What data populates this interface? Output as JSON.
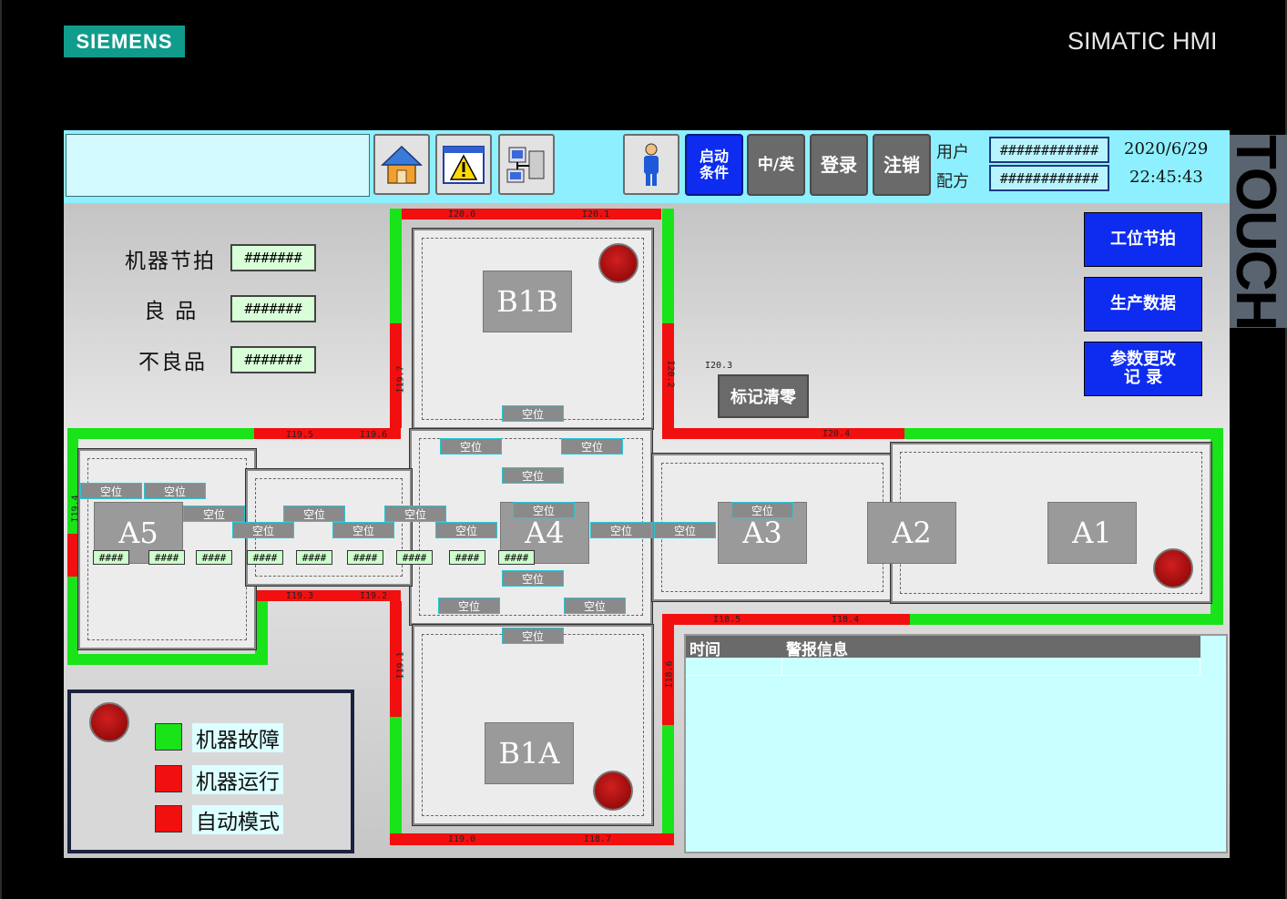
{
  "brand": {
    "logo": "SIEMENS",
    "product": "SIMATIC HMI",
    "panel_label": "TOUCH"
  },
  "topbar": {
    "icons": [
      "home-icon",
      "warning-icon",
      "network-icon",
      "operator-icon"
    ],
    "buttons": {
      "start_condition": "启动\n条件",
      "lang": "中/英",
      "login": "登录",
      "logout": "注销"
    },
    "user_label": "用户",
    "recipe_label": "配方",
    "user_value": "############",
    "recipe_value": "############",
    "date": "2020/6/29",
    "time": "22:45:43"
  },
  "stats": {
    "cycle_label": "机器节拍",
    "good_label": "良 品",
    "bad_label": "不良品",
    "cycle_value": "#######",
    "good_value": "#######",
    "bad_value": "#######"
  },
  "right_buttons": {
    "station_cycle": "工位节拍",
    "production_data": "生产数据",
    "param_log": "参数更改\n记 录"
  },
  "clear": {
    "label": "标记清零",
    "addr": "I20.3"
  },
  "stations": [
    "B1B",
    "B1A",
    "A5",
    "A4",
    "A3",
    "A2",
    "A1"
  ],
  "slot_label": "空位",
  "counter_value": "####",
  "sensor_addrs": [
    "I20.0",
    "I20.1",
    "I19.7",
    "I20.2",
    "I19.5",
    "I19.6",
    "I20.4",
    "I19.4",
    "I19.3",
    "I19.2",
    "I18.5",
    "I18.4",
    "I19.1",
    "I18.6",
    "I19.0",
    "I18.7"
  ],
  "alarm": {
    "col_time": "时间",
    "col_msg": "警报信息"
  },
  "legend": {
    "fault": "机器故障",
    "running": "机器运行",
    "auto": "自动模式"
  },
  "colors": {
    "on": "#19e319",
    "off": "#f20f0f",
    "header": "#8ef0ff",
    "accent_blue": "#0d2cf0"
  }
}
